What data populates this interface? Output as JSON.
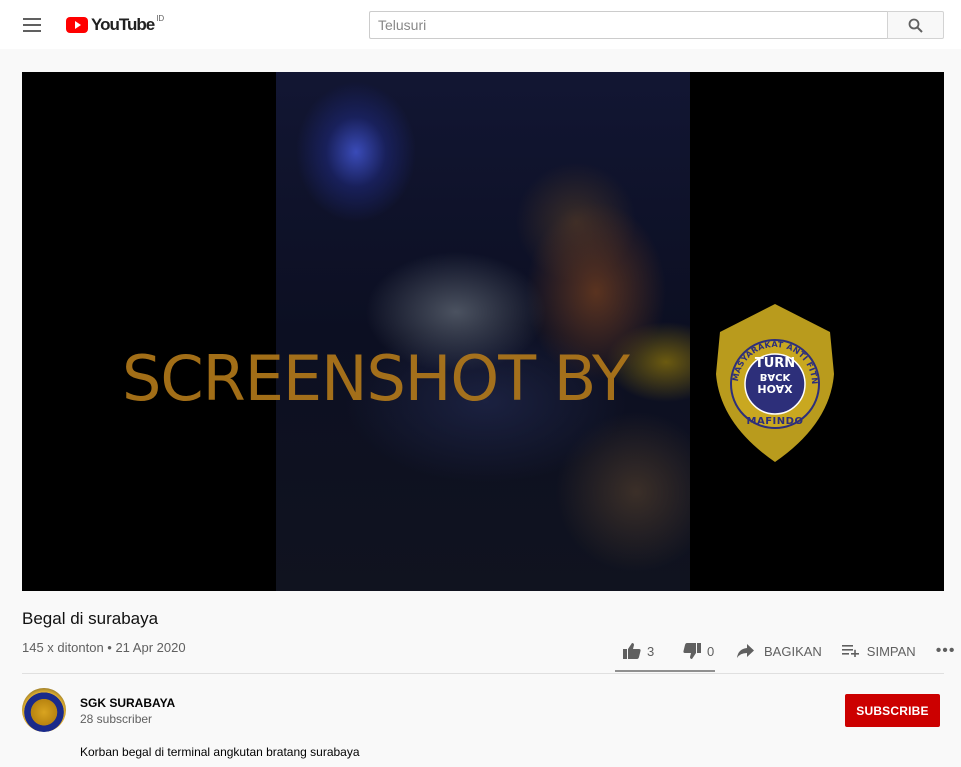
{
  "header": {
    "logo_text": "YouTube",
    "country_code": "ID",
    "search_placeholder": "Telusuri",
    "search_value": ""
  },
  "video": {
    "watermark_text": "SCREENSHOT BY",
    "badge": {
      "arc_text": "MASYARAKAT ANTI FITNAH INDONESIA",
      "turn": "TURN",
      "back": "BACK",
      "hoax": "HOAX",
      "mafindo": "MAFINDO"
    },
    "title": "Begal di surabaya",
    "meta": "145 x ditonton • 21 Apr 2020"
  },
  "actions": {
    "like_count": "3",
    "dislike_count": "0",
    "share_label": "BAGIKAN",
    "save_label": "SIMPAN",
    "more_label": "•••"
  },
  "channel": {
    "name": "SGK SURABAYA",
    "subscribers": "28 subscriber",
    "subscribe_label": "SUBSCRIBE"
  },
  "description": "Korban begal di terminal angkutan bratang surabaya",
  "colors": {
    "brand_red": "#ff0000",
    "subscribe_red": "#cc0000",
    "badge_gold": "#c9a820",
    "badge_navy": "#2d2f7a",
    "watermark": "#b47a1a"
  }
}
